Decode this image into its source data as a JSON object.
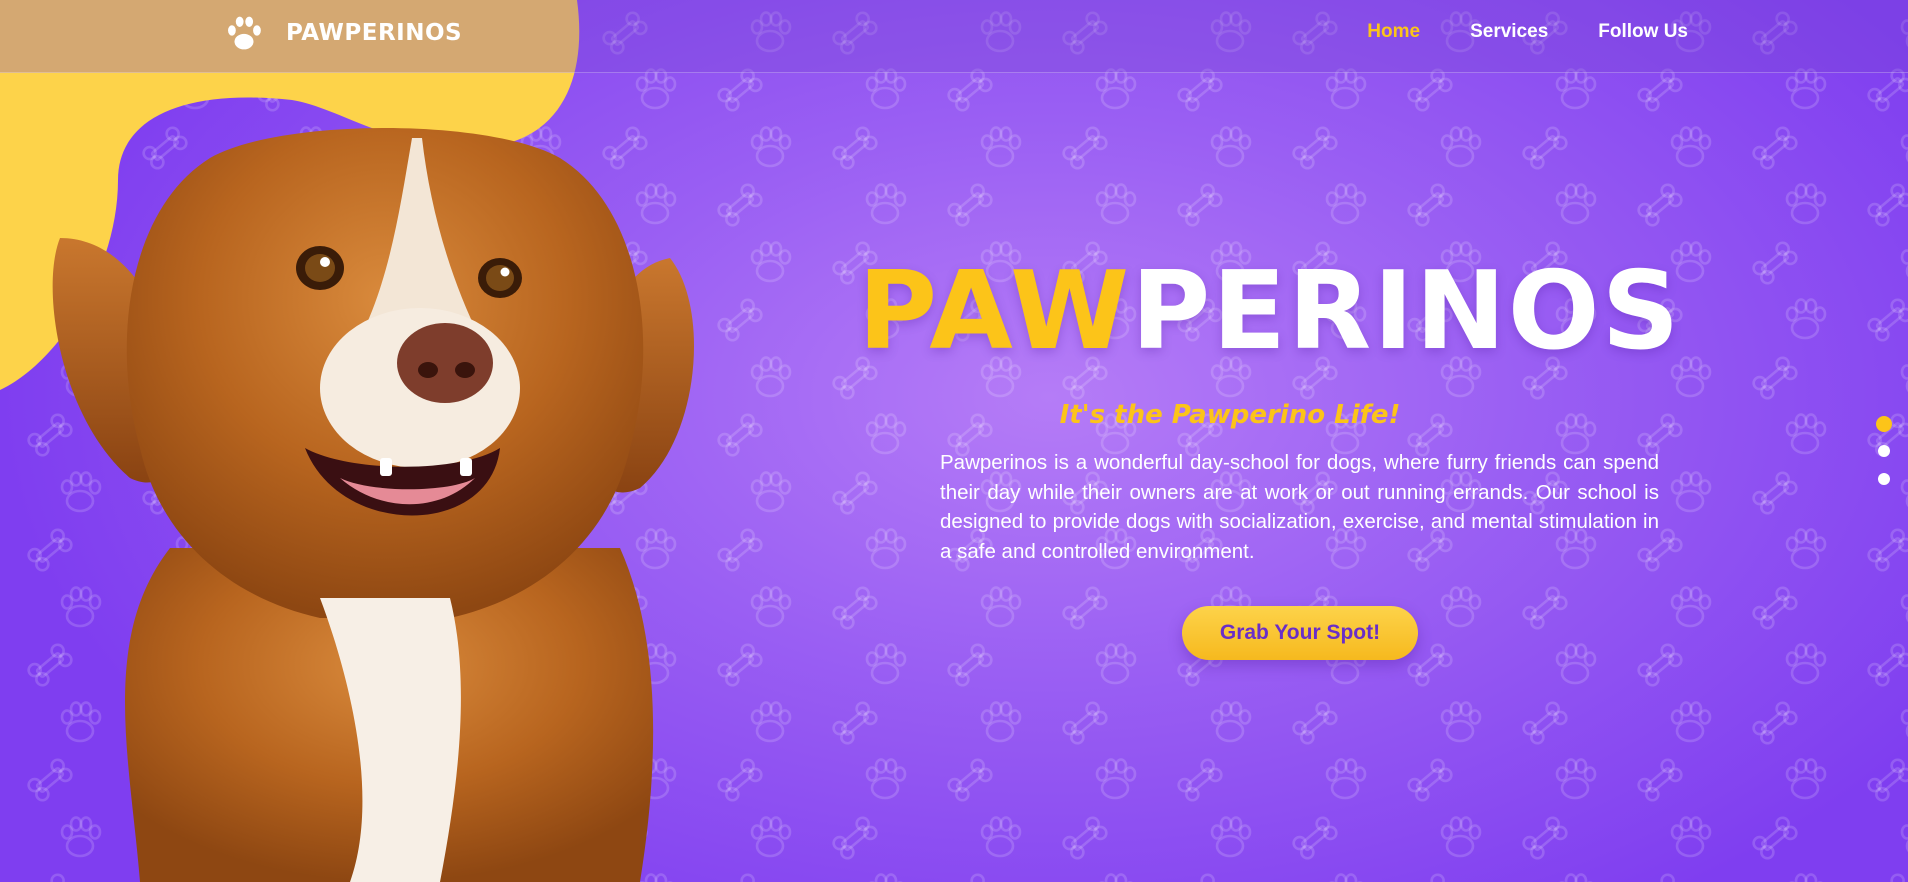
{
  "colors": {
    "purple": "#8b4cf2",
    "yellow": "#fcc419",
    "white": "#ffffff",
    "cta_text": "#6a2ec8"
  },
  "brand": {
    "logo_icon": "paw-icon",
    "name": "PAWPERINOS"
  },
  "nav": {
    "items": [
      {
        "label": "Home",
        "active": true
      },
      {
        "label": "Services",
        "active": false
      },
      {
        "label": "Follow Us",
        "active": false
      }
    ]
  },
  "hero": {
    "image": "dog-photo",
    "title_highlight": "PAW",
    "title_rest": "PERINOS",
    "tagline": "It's the Pawperino Life!",
    "description": "Pawperinos is a wonderful day-school for dogs, where furry friends can spend their day while their owners are at work or out running errands. Our school is designed to provide dogs with socialization, exercise, and mental stimulation in a safe and controlled environment.",
    "cta_label": "Grab Your Spot!"
  },
  "slider": {
    "count": 3,
    "active_index": 0
  },
  "background_pattern": [
    "paw-print-icon",
    "bone-icon"
  ]
}
